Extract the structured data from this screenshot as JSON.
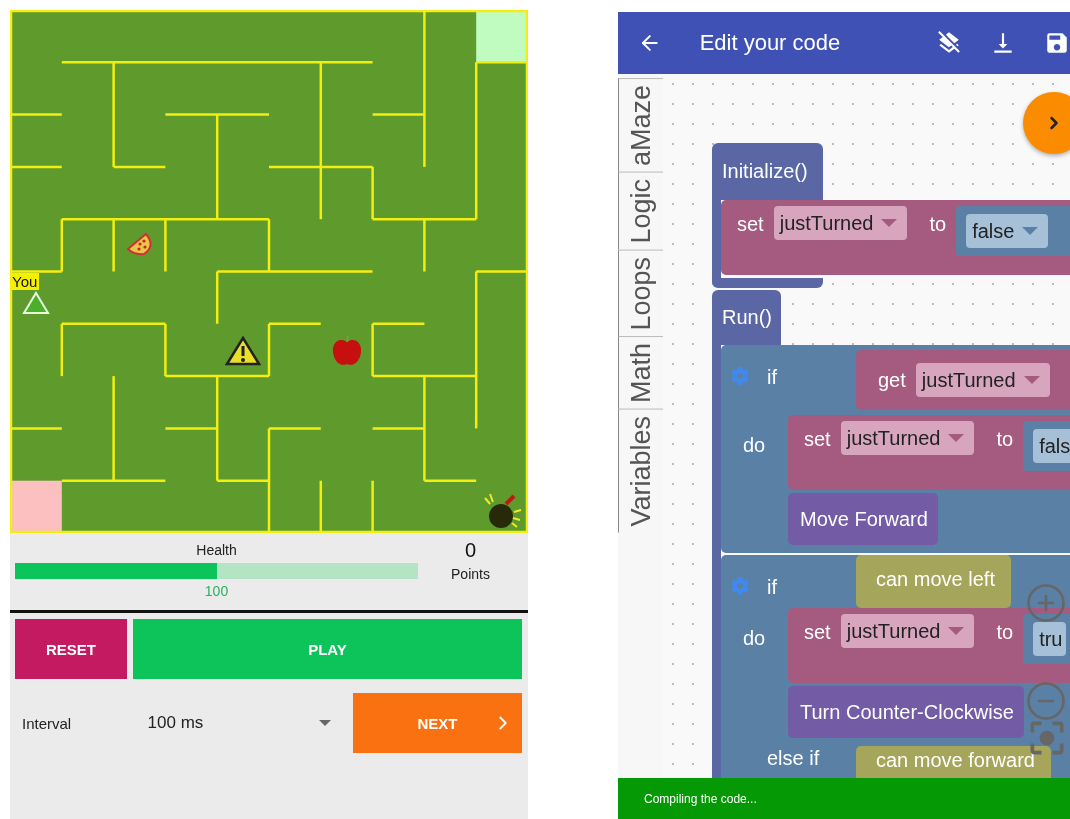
{
  "game": {
    "maze": {
      "player_label": "You"
    },
    "health": {
      "label": "Health",
      "level": 0.5,
      "reading": "100"
    },
    "points": {
      "value": "0",
      "label": "Points"
    },
    "buttons": [
      {
        "label": "RESET",
        "kind": "reset"
      },
      {
        "label": "PLAY",
        "kind": "play"
      }
    ],
    "interval": {
      "label": "Interval",
      "value": "100 ms"
    },
    "next_button": {
      "label": "NEXT"
    }
  },
  "editor": {
    "app_bar": {
      "title": "Edit your code"
    },
    "categories": [
      {
        "label": "aMaze"
      },
      {
        "label": "Logic"
      },
      {
        "label": "Loops"
      },
      {
        "label": "Math"
      },
      {
        "label": "Variables"
      }
    ],
    "blocks": [
      {
        "kind": "event",
        "label": "Initialize()",
        "children": [
          {
            "kind": "set",
            "label": "set",
            "variable": "justTurned",
            "to": "to",
            "value": "false"
          }
        ]
      },
      {
        "kind": "event",
        "label": "Run()",
        "children": [
          {
            "kind": "if",
            "branches": [
              {
                "keyword": "if",
                "condition": {
                  "kind": "get",
                  "label": "get",
                  "variable": "justTurned"
                },
                "do": "do",
                "children": [
                  {
                    "kind": "set",
                    "label": "set",
                    "variable": "justTurned",
                    "to": "to",
                    "value": "fals"
                  },
                  {
                    "kind": "action",
                    "label": "Move Forward"
                  }
                ]
              }
            ]
          },
          {
            "kind": "if",
            "branches": [
              {
                "keyword": "if",
                "condition": {
                  "kind": "sensor",
                  "label": "can move left"
                },
                "do": "do",
                "children": [
                  {
                    "kind": "set",
                    "label": "set",
                    "variable": "justTurned",
                    "to": "to",
                    "value": "tru"
                  },
                  {
                    "kind": "action",
                    "label": "Turn Counter-Clockwise"
                  }
                ]
              },
              {
                "keyword": "else if",
                "condition": {
                  "kind": "sensor",
                  "label": "can move forward"
                }
              }
            ]
          }
        ]
      }
    ],
    "snackbar": {
      "message": "Compiling the code..."
    }
  }
}
